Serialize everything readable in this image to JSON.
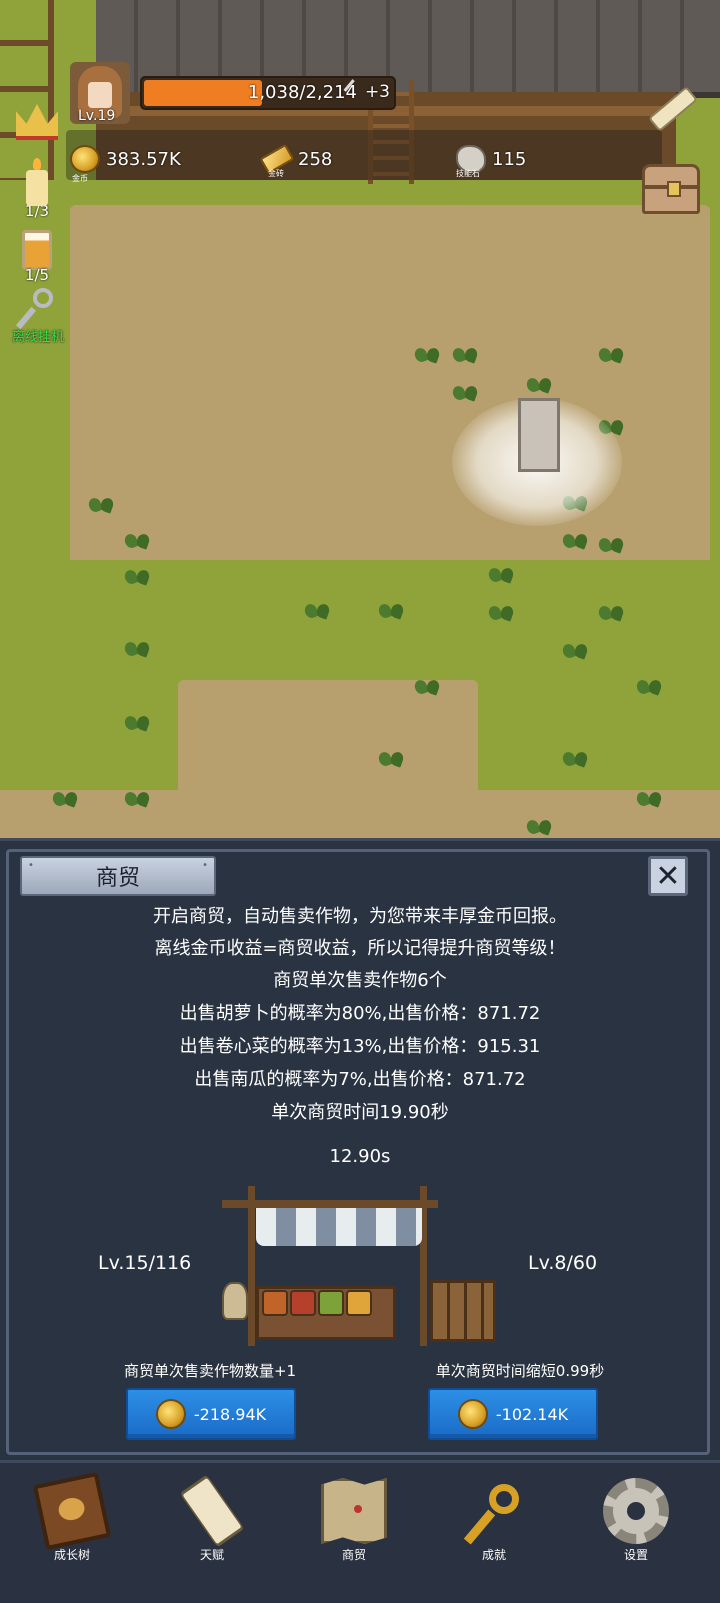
{
  "hud": {
    "level": "Lv.19",
    "xp_text": "1,038/2,214",
    "xp_fraction": 0.469,
    "xp_bonus": "+3",
    "resources": [
      {
        "name": "金币",
        "value": "383.57K",
        "icon": "coin-icon"
      },
      {
        "name": "金砖",
        "value": "258",
        "icon": "gold-bar-icon"
      },
      {
        "name": "技能石",
        "value": "115",
        "icon": "skill-stone-icon"
      }
    ],
    "side": {
      "candle_count": "1/3",
      "beer_count": "1/5",
      "idle_label": "离线挂机"
    }
  },
  "trade_panel": {
    "title": "商贸",
    "close_icon": "✕",
    "lines": [
      "开启商贸，自动售卖作物，为您带来丰厚金币回报。",
      "离线金币收益=商贸收益，所以记得提升商贸等级！",
      "商贸单次售卖作物6个",
      "出售胡萝卜的概率为80%,出售价格：871.72",
      "出售卷心菜的概率为13%,出售价格：915.31",
      "出售南瓜的概率为7%,出售价格：871.72",
      "单次商贸时间19.90秒"
    ],
    "timer": "12.90s",
    "left_level": "Lv.15/116",
    "right_level": "Lv.8/60",
    "left_upgrade_label": "商贸单次售卖作物数量+1",
    "right_upgrade_label": "单次商贸时间缩短0.99秒",
    "left_cost": "-218.94K",
    "right_cost": "-102.14K"
  },
  "nav": [
    {
      "label": "成长树",
      "icon": "book-icon"
    },
    {
      "label": "天赋",
      "icon": "scroll-icon"
    },
    {
      "label": "商贸",
      "icon": "map-icon"
    },
    {
      "label": "成就",
      "icon": "key-icon"
    },
    {
      "label": "设置",
      "icon": "gear-icon"
    }
  ],
  "colors": {
    "xp_fill": "#ef7d21",
    "panel_bg": "#2a3342",
    "button_blue": "#2d8fe6",
    "idle_green": "#35e04a"
  }
}
